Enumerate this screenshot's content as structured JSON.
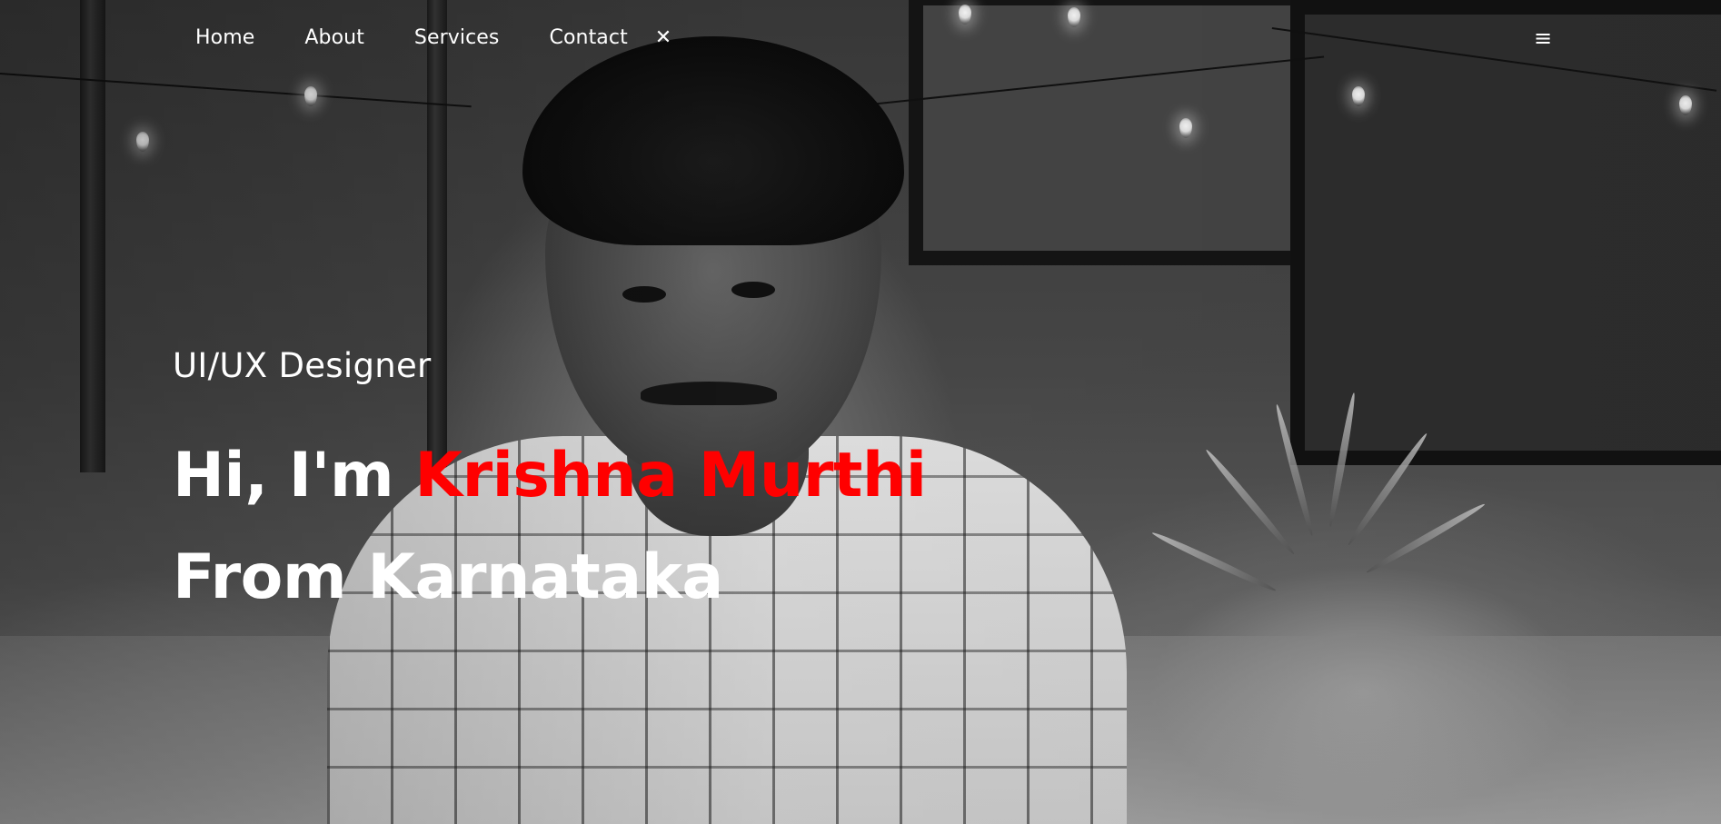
{
  "nav": {
    "items": [
      {
        "label": "Home"
      },
      {
        "label": "About"
      },
      {
        "label": "Services"
      },
      {
        "label": "Contact"
      }
    ],
    "close_label": "✕",
    "menu_label": "≡"
  },
  "hero": {
    "role": "UI/UX Designer",
    "greeting": "Hi, I'm ",
    "name": "Krishna Murthi",
    "line2": "From Karnataka"
  },
  "colors": {
    "accent": "#ff0000",
    "text": "#ffffff"
  },
  "icons": {
    "close": "close-icon",
    "menu": "hamburger-menu-icon"
  }
}
